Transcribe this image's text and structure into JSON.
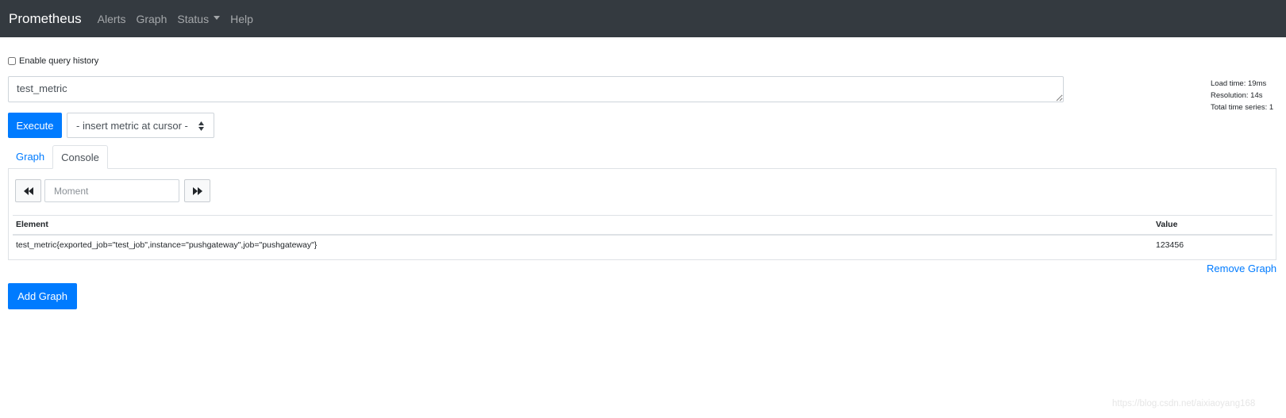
{
  "navbar": {
    "brand": "Prometheus",
    "links": [
      {
        "label": "Alerts"
      },
      {
        "label": "Graph"
      },
      {
        "label": "Status"
      },
      {
        "label": "Help"
      }
    ]
  },
  "query_history": {
    "label": "Enable query history",
    "checked": false
  },
  "expression": {
    "value": "test_metric"
  },
  "stats": {
    "load_time": "Load time: 19ms",
    "resolution": "Resolution: 14s",
    "total_series": "Total time series: 1"
  },
  "execute_label": "Execute",
  "metric_select": {
    "selected": "- insert metric at cursor -"
  },
  "tabs": [
    {
      "label": "Graph",
      "active": false
    },
    {
      "label": "Console",
      "active": true
    }
  ],
  "console": {
    "moment_placeholder": "Moment",
    "columns": [
      "Element",
      "Value"
    ],
    "rows": [
      {
        "element": "test_metric{exported_job=\"test_job\",instance=\"pushgateway\",job=\"pushgateway\"}",
        "value": "123456"
      }
    ]
  },
  "remove_graph_label": "Remove Graph",
  "add_graph_label": "Add Graph",
  "watermark": "https://blog.csdn.net/aixiaoyang168",
  "colors": {
    "navbar_bg": "#343a40",
    "primary": "#007bff",
    "border": "#dee2e6"
  },
  "icons": {
    "prev": "backward-icon",
    "next": "forward-icon",
    "status_dropdown": "caret-down-icon",
    "select_arrows": "updown-arrows-icon"
  }
}
